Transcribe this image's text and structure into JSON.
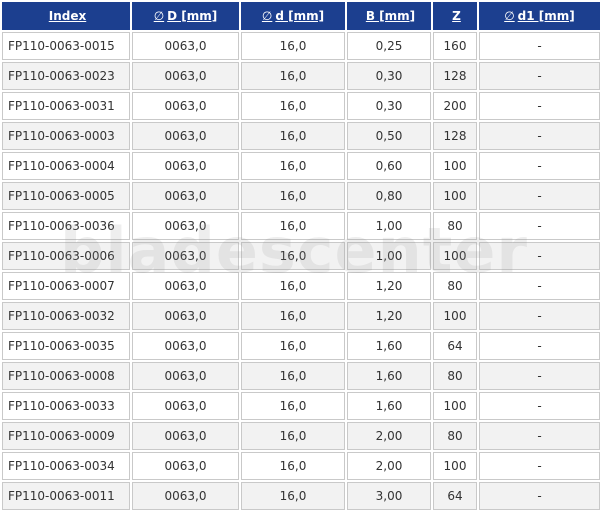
{
  "table": {
    "columns": [
      {
        "symbol": "",
        "label": "Index"
      },
      {
        "symbol": "∅",
        "label": "D [mm]"
      },
      {
        "symbol": "∅",
        "label": "d [mm]"
      },
      {
        "symbol": "",
        "label": "B [mm]"
      },
      {
        "symbol": "",
        "label": "Z"
      },
      {
        "symbol": "∅",
        "label": "d1 [mm]"
      }
    ],
    "rows": [
      [
        "FP110-0063-0015",
        "0063,0",
        "16,0",
        "0,25",
        "160",
        "-"
      ],
      [
        "FP110-0063-0023",
        "0063,0",
        "16,0",
        "0,30",
        "128",
        "-"
      ],
      [
        "FP110-0063-0031",
        "0063,0",
        "16,0",
        "0,30",
        "200",
        "-"
      ],
      [
        "FP110-0063-0003",
        "0063,0",
        "16,0",
        "0,50",
        "128",
        "-"
      ],
      [
        "FP110-0063-0004",
        "0063,0",
        "16,0",
        "0,60",
        "100",
        "-"
      ],
      [
        "FP110-0063-0005",
        "0063,0",
        "16,0",
        "0,80",
        "100",
        "-"
      ],
      [
        "FP110-0063-0036",
        "0063,0",
        "16,0",
        "1,00",
        "80",
        "-"
      ],
      [
        "FP110-0063-0006",
        "0063,0",
        "16,0",
        "1,00",
        "100",
        "-"
      ],
      [
        "FP110-0063-0007",
        "0063,0",
        "16,0",
        "1,20",
        "80",
        "-"
      ],
      [
        "FP110-0063-0032",
        "0063,0",
        "16,0",
        "1,20",
        "100",
        "-"
      ],
      [
        "FP110-0063-0035",
        "0063,0",
        "16,0",
        "1,60",
        "64",
        "-"
      ],
      [
        "FP110-0063-0008",
        "0063,0",
        "16,0",
        "1,60",
        "80",
        "-"
      ],
      [
        "FP110-0063-0033",
        "0063,0",
        "16,0",
        "1,60",
        "100",
        "-"
      ],
      [
        "FP110-0063-0009",
        "0063,0",
        "16,0",
        "2,00",
        "80",
        "-"
      ],
      [
        "FP110-0063-0034",
        "0063,0",
        "16,0",
        "2,00",
        "100",
        "-"
      ],
      [
        "FP110-0063-0011",
        "0063,0",
        "16,0",
        "3,00",
        "64",
        "-"
      ]
    ]
  },
  "watermark": "bladescenter",
  "colors": {
    "header_bg": "#1c3f8f",
    "header_text": "#ffffff",
    "cell_border": "#c9c9c9",
    "alt_row_bg": "#f2f2f2"
  }
}
